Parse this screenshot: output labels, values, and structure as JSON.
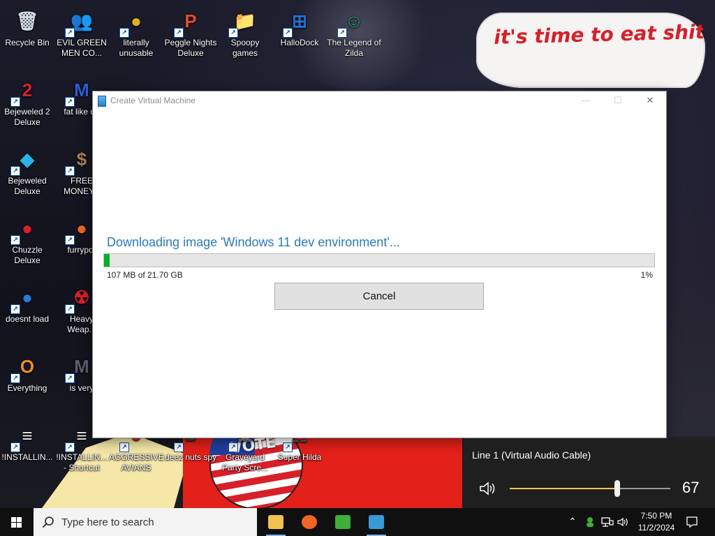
{
  "wallpaper": {
    "caption": "it's time to eat shit and die and go trick or treating and vote!",
    "flag_text": "VOTE"
  },
  "desktop_icons": [
    {
      "label": "Recycle Bin",
      "glyph": "🗑",
      "color": "#cfd8e3"
    },
    {
      "label": "EVIL GREEN MEN CO...",
      "glyph": "👥",
      "color": "#3fae3a"
    },
    {
      "label": "literally unusable",
      "glyph": "●",
      "color": "#e0b020"
    },
    {
      "label": "Peggle Nights Deluxe",
      "glyph": "P",
      "color": "#e84a2a"
    },
    {
      "label": "Spoopy games",
      "glyph": "📁",
      "color": "#e8b94a"
    },
    {
      "label": "HalloDock",
      "glyph": "⊞",
      "color": "#2b6fd4"
    },
    {
      "label": "The Legend of Zilda",
      "glyph": "☺",
      "color": "#2aa57a"
    },
    {
      "label": "Bejeweled 2 Deluxe",
      "glyph": "2",
      "color": "#d8202a"
    },
    {
      "label": "fat like da",
      "glyph": "M",
      "color": "#2a5fd8"
    },
    {
      "label": "Bejeweled Deluxe",
      "glyph": "◆",
      "color": "#29b5e8"
    },
    {
      "label": "FREE MONEY.c",
      "glyph": "$",
      "color": "#a88452"
    },
    {
      "label": "Chuzzle Deluxe",
      "glyph": "●",
      "color": "#d8202a"
    },
    {
      "label": "furrypor",
      "glyph": "●",
      "color": "#f26522"
    },
    {
      "label": "doesnt load",
      "glyph": "●",
      "color": "#2a7ad8"
    },
    {
      "label": "Heavy Weap...",
      "glyph": "☢",
      "color": "#d8202a"
    },
    {
      "label": "Everything",
      "glyph": "O",
      "color": "#f28a1f"
    },
    {
      "label": "is very",
      "glyph": "M",
      "color": "#5a6070"
    },
    {
      "label": "!INSTALLIN...",
      "glyph": "≡",
      "color": "#f2f2f2"
    },
    {
      "label": "!INSTALLIN... - Shortcut",
      "glyph": "≡",
      "color": "#f2f2f2"
    },
    {
      "label": "AGGRESSIVE AVIANS",
      "glyph": "●",
      "color": "#d8202a"
    },
    {
      "label": "deez nuts spy",
      "glyph": "■",
      "color": "#444"
    },
    {
      "label": "Graveyard Party Scre...",
      "glyph": "☠",
      "color": "#888"
    },
    {
      "label": "Super Hilda",
      "glyph": "☷",
      "color": "#555"
    }
  ],
  "dialog": {
    "title": "Create Virtual Machine",
    "status": "Downloading image 'Windows 11 dev environment'...",
    "progress_text": "107 MB of 21.70 GB",
    "progress_percent_text": "1%",
    "progress_fraction": 0.01,
    "cancel_label": "Cancel",
    "minimize_glyph": "—",
    "maximize_glyph": "☐",
    "close_glyph": "✕"
  },
  "volume": {
    "device": "Line 1 (Virtual Audio Cable)",
    "value": "67",
    "level": 0.67,
    "accent": "#f3c64d"
  },
  "taskbar": {
    "search_placeholder": "Type here to search",
    "apps": [
      {
        "name": "file-explorer-icon",
        "color": "#f2c24f"
      },
      {
        "name": "firefox-icon",
        "color": "#f26522"
      },
      {
        "name": "green-men-icon",
        "color": "#3fae3a"
      },
      {
        "name": "hallodock-icon",
        "color": "#3a9ad8"
      }
    ],
    "time": "7:50 PM",
    "date": "11/2/2024"
  }
}
